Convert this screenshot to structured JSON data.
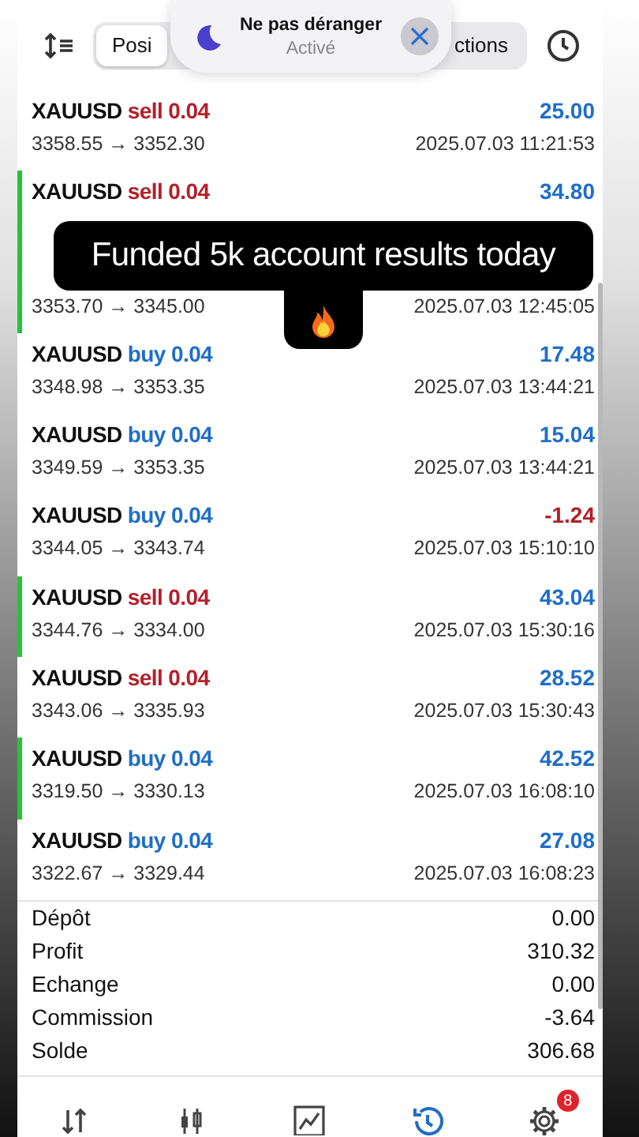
{
  "top_bar": {
    "segments": [
      {
        "label": "Posi",
        "selected": true
      },
      {
        "label": "ctions",
        "selected": false
      }
    ]
  },
  "notification": {
    "title": "Ne pas déranger",
    "status": "Activé"
  },
  "overlay_caption": "Funded 5k account results today",
  "trades": [
    {
      "symbol": "XAUUSD",
      "order": "sell 0.04",
      "kind": "sell",
      "profit": "25.00",
      "loss": false,
      "prices": "3358.55 → 3352.30",
      "time": "2025.07.03 11:21:53",
      "highlighted": false
    },
    {
      "symbol": "XAUUSD",
      "order": "sell 0.04",
      "kind": "sell",
      "profit": "34.80",
      "loss": false,
      "highlighted": true
    },
    {
      "prices": "3353.70 → 3345.00",
      "time": "2025.07.03 12:45:05",
      "highlighted": true
    },
    {
      "symbol": "XAUUSD",
      "order": "buy 0.04",
      "kind": "buy",
      "profit": "17.48",
      "loss": false,
      "prices": "3348.98 → 3353.35",
      "time": "2025.07.03 13:44:21",
      "highlighted": false
    },
    {
      "symbol": "XAUUSD",
      "order": "buy 0.04",
      "kind": "buy",
      "profit": "15.04",
      "loss": false,
      "prices": "3349.59 → 3353.35",
      "time": "2025.07.03 13:44:21",
      "highlighted": false
    },
    {
      "symbol": "XAUUSD",
      "order": "buy 0.04",
      "kind": "buy",
      "profit": "-1.24",
      "loss": true,
      "prices": "3344.05 → 3343.74",
      "time": "2025.07.03 15:10:10",
      "highlighted": false
    },
    {
      "symbol": "XAUUSD",
      "order": "sell 0.04",
      "kind": "sell",
      "profit": "43.04",
      "loss": false,
      "prices": "3344.76 → 3334.00",
      "time": "2025.07.03 15:30:16",
      "highlighted": true
    },
    {
      "symbol": "XAUUSD",
      "order": "sell 0.04",
      "kind": "sell",
      "profit": "28.52",
      "loss": false,
      "prices": "3343.06 → 3335.93",
      "time": "2025.07.03 15:30:43",
      "highlighted": false
    },
    {
      "symbol": "XAUUSD",
      "order": "buy 0.04",
      "kind": "buy",
      "profit": "42.52",
      "loss": false,
      "prices": "3319.50 → 3330.13",
      "time": "2025.07.03 16:08:10",
      "highlighted": true
    },
    {
      "symbol": "XAUUSD",
      "order": "buy 0.04",
      "kind": "buy",
      "profit": "27.08",
      "loss": false,
      "prices": "3322.67 → 3329.44",
      "time": "2025.07.03 16:08:23",
      "highlighted": false
    }
  ],
  "summary": [
    {
      "label": "Dépôt",
      "value": "0.00"
    },
    {
      "label": "Profit",
      "value": "310.32"
    },
    {
      "label": "Echange",
      "value": "0.00"
    },
    {
      "label": "Commission",
      "value": "-3.64"
    },
    {
      "label": "Solde",
      "value": "306.68"
    }
  ],
  "tab_bar": [
    {
      "kind": "trade",
      "selected": false
    },
    {
      "kind": "quotes",
      "selected": false
    },
    {
      "kind": "chart",
      "selected": false
    },
    {
      "kind": "history",
      "selected": true
    },
    {
      "kind": "settings",
      "selected": false,
      "badge": "8"
    }
  ]
}
